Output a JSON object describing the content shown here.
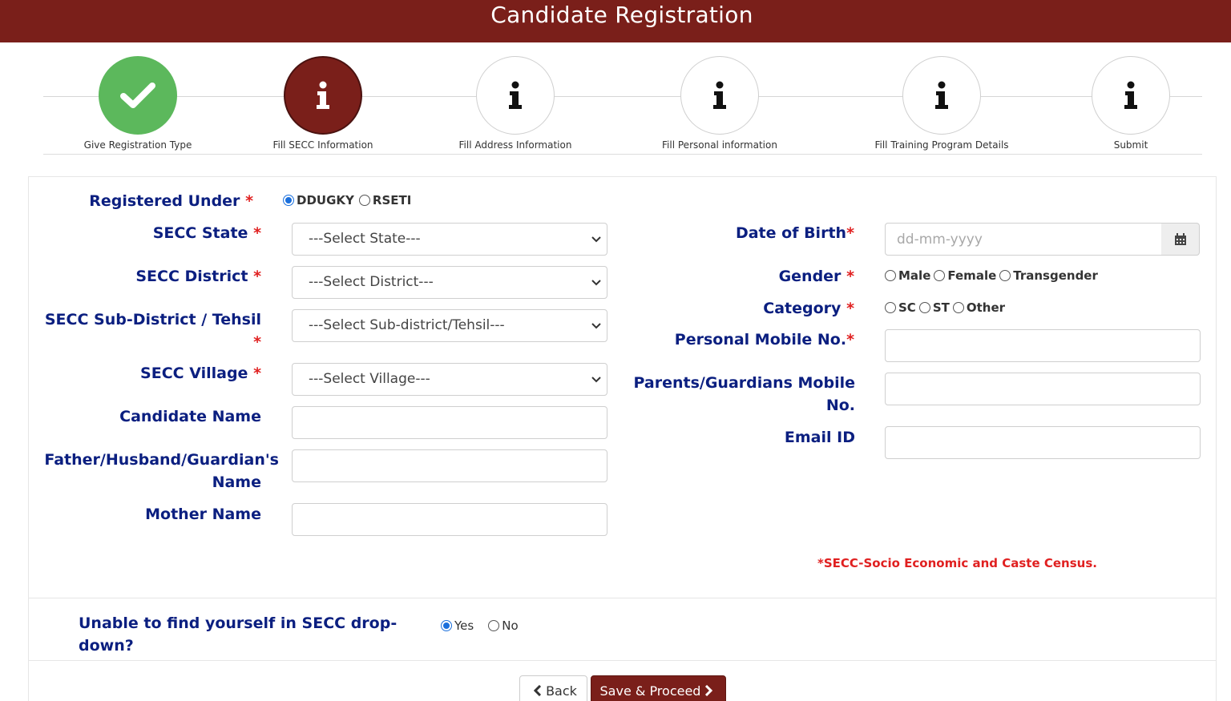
{
  "header": {
    "title": "Candidate Registration"
  },
  "steps": [
    {
      "label": "Give Registration Type",
      "state": "done",
      "icon": "check-icon"
    },
    {
      "label": "Fill SECC Information",
      "state": "active",
      "icon": "info-icon"
    },
    {
      "label": "Fill Address Information",
      "state": "pending",
      "icon": "info-icon"
    },
    {
      "label": "Fill Personal information",
      "state": "pending",
      "icon": "info-icon"
    },
    {
      "label": "Fill Training Program Details",
      "state": "pending",
      "icon": "info-icon"
    },
    {
      "label": "Submit",
      "state": "pending",
      "icon": "info-icon"
    }
  ],
  "form": {
    "registered_under": {
      "label": "Registered Under",
      "req": "*",
      "options": [
        "DDUGKY",
        "RSETI"
      ],
      "selected": "DDUGKY"
    },
    "secc_state": {
      "label": "SECC State",
      "req": "*",
      "value": "---Select State---"
    },
    "secc_district": {
      "label": "SECC District",
      "req": "*",
      "value": "---Select District---"
    },
    "secc_subdistrict": {
      "label": "SECC Sub-District / Tehsil",
      "req": "*",
      "value": "---Select Sub-district/Tehsil---"
    },
    "secc_village": {
      "label": "SECC Village",
      "req": "*",
      "value": "---Select Village---"
    },
    "candidate_name": {
      "label": "Candidate Name",
      "value": ""
    },
    "guardian_name": {
      "label_line1": "Father/Husband/Guardian's",
      "label_line2": "Name",
      "value": ""
    },
    "mother_name": {
      "label": "Mother Name",
      "value": ""
    },
    "dob": {
      "label": "Date of Birth",
      "req": "*",
      "placeholder": "dd-mm-yyyy",
      "value": ""
    },
    "gender": {
      "label": "Gender",
      "req": "*",
      "options": [
        "Male",
        "Female",
        "Transgender"
      ]
    },
    "category": {
      "label": "Category",
      "req": "*",
      "options": [
        "SC",
        "ST",
        "Other"
      ]
    },
    "personal_mobile": {
      "label": "Personal Mobile No.",
      "req": "*",
      "value": ""
    },
    "parent_mobile": {
      "label_line1": "Parents/Guardians Mobile",
      "label_line2": "No.",
      "value": ""
    },
    "email": {
      "label": "Email ID",
      "value": ""
    },
    "footnote": "*SECC-Socio Economic and Caste Census."
  },
  "unable": {
    "question": "Unable to find yourself in SECC drop-down?",
    "options": [
      "Yes",
      "No"
    ],
    "selected": "Yes"
  },
  "buttons": {
    "back": "Back",
    "save": "Save & Proceed"
  },
  "colors": {
    "header": "#7a1f1a",
    "done": "#5cb85c",
    "label": "#0b1f80",
    "required": "#e02020",
    "radio": "#1a6fdc"
  }
}
